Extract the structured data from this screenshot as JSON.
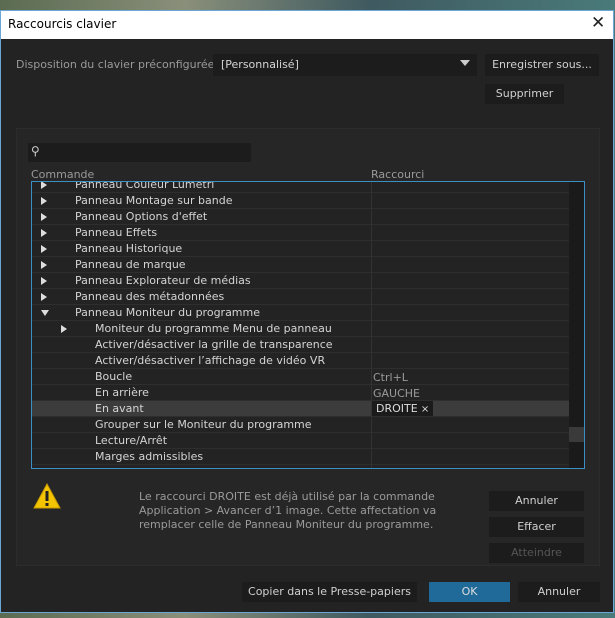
{
  "window": {
    "title": "Raccourcis clavier",
    "close_icon": "close-icon"
  },
  "preset": {
    "label": "Disposition du clavier préconfigurée :",
    "value": "[Personnalisé]",
    "save_as": "Enregistrer sous...",
    "delete": "Supprimer"
  },
  "search": {
    "placeholder": "",
    "value": ""
  },
  "table": {
    "col_command": "Commande",
    "col_shortcut": "Raccourci",
    "rows": [
      {
        "label": "Panneau Couleur Lumetri",
        "level": 1,
        "toggle": "collapsed",
        "shortcut": ""
      },
      {
        "label": "Panneau Montage sur bande",
        "level": 1,
        "toggle": "collapsed",
        "shortcut": ""
      },
      {
        "label": "Panneau Options d'effet",
        "level": 1,
        "toggle": "collapsed",
        "shortcut": ""
      },
      {
        "label": "Panneau Effets",
        "level": 1,
        "toggle": "collapsed",
        "shortcut": ""
      },
      {
        "label": "Panneau Historique",
        "level": 1,
        "toggle": "collapsed",
        "shortcut": ""
      },
      {
        "label": "Panneau de marque",
        "level": 1,
        "toggle": "collapsed",
        "shortcut": ""
      },
      {
        "label": "Panneau Explorateur de médias",
        "level": 1,
        "toggle": "collapsed",
        "shortcut": ""
      },
      {
        "label": "Panneau des métadonnées",
        "level": 1,
        "toggle": "collapsed",
        "shortcut": ""
      },
      {
        "label": "Panneau Moniteur du programme",
        "level": 1,
        "toggle": "expanded",
        "shortcut": ""
      },
      {
        "label": "Moniteur du programme Menu de panneau",
        "level": 2,
        "toggle": "collapsed",
        "shortcut": ""
      },
      {
        "label": "Activer/désactiver la grille de transparence",
        "level": 2,
        "toggle": "none",
        "shortcut": ""
      },
      {
        "label": "Activer/désactiver l’affichage de vidéo VR",
        "level": 2,
        "toggle": "none",
        "shortcut": ""
      },
      {
        "label": "Boucle",
        "level": 2,
        "toggle": "none",
        "shortcut": "Ctrl+L"
      },
      {
        "label": "En arrière",
        "level": 2,
        "toggle": "none",
        "shortcut": "GAUCHE"
      },
      {
        "label": "En avant",
        "level": 2,
        "toggle": "none",
        "shortcut": "DROITE",
        "selected": true,
        "editing": true
      },
      {
        "label": "Grouper sur le Moniteur du programme",
        "level": 2,
        "toggle": "none",
        "shortcut": ""
      },
      {
        "label": "Lecture/Arrêt",
        "level": 2,
        "toggle": "none",
        "shortcut": ""
      },
      {
        "label": "Marges admissibles",
        "level": 2,
        "toggle": "none",
        "shortcut": ""
      }
    ]
  },
  "warning": {
    "icon": "warning-icon",
    "message": "Le raccourci DROITE est déjà utilisé par la commande Application > Avancer d’1 image. Cette affectation va remplacer celle de Panneau Moniteur du programme.",
    "undo": "Annuler",
    "clear": "Effacer",
    "goto": "Atteindre"
  },
  "footer": {
    "copy": "Copier dans le Presse-papiers",
    "ok": "OK",
    "cancel": "Annuler"
  },
  "colors": {
    "accent": "#1f6a99",
    "table_border": "#3b8fc4",
    "warning": "#f2c500"
  }
}
